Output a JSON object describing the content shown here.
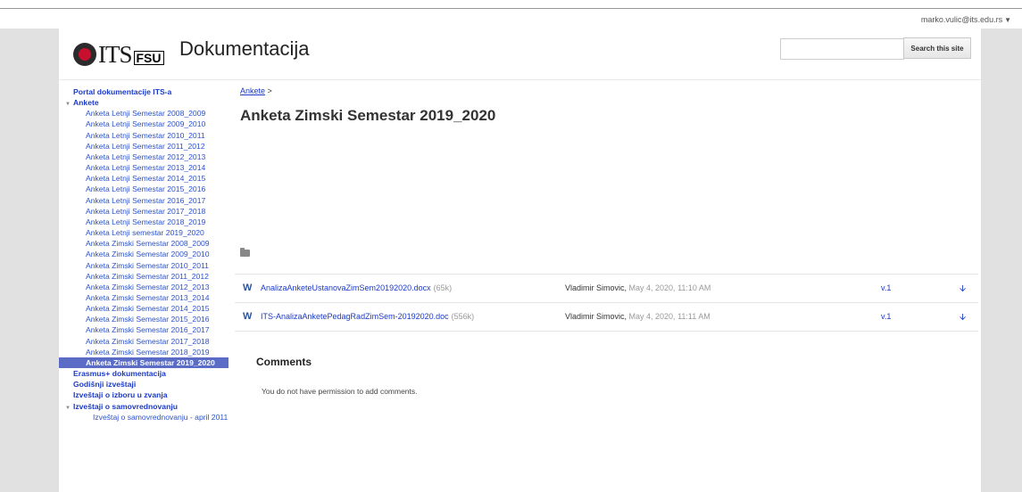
{
  "header": {
    "user_email": "marko.vulic@its.edu.rs",
    "site_title": "Dokumentacija",
    "search_button": "Search this site",
    "search_placeholder": "",
    "logo_text_its": "ITS",
    "logo_text_fsu": "FSU"
  },
  "sidebar": {
    "items": [
      {
        "label": "Portal dokumentacije ITS-a",
        "level": 0
      },
      {
        "label": "Ankete",
        "level": 0,
        "expanded": true
      },
      {
        "label": "Anketa Letnji Semestar 2008_2009",
        "level": 1
      },
      {
        "label": "Anketa Letnji Semestar 2009_2010",
        "level": 1
      },
      {
        "label": "Anketa Letnji Semestar 2010_2011",
        "level": 1
      },
      {
        "label": "Anketa Letnji Semestar 2011_2012",
        "level": 1
      },
      {
        "label": "Anketa Letnji Semestar 2012_2013",
        "level": 1
      },
      {
        "label": "Anketa Letnji Semestar 2013_2014",
        "level": 1
      },
      {
        "label": "Anketa Letnji Semestar 2014_2015",
        "level": 1
      },
      {
        "label": "Anketa Letnji Semestar 2015_2016",
        "level": 1
      },
      {
        "label": "Anketa Letnji Semestar 2016_2017",
        "level": 1
      },
      {
        "label": "Anketa Letnji Semestar 2017_2018",
        "level": 1
      },
      {
        "label": "Anketa Letnji Semestar 2018_2019",
        "level": 1
      },
      {
        "label": "Anketa Letnji semestar 2019_2020",
        "level": 1
      },
      {
        "label": "Anketa Zimski Semestar 2008_2009",
        "level": 1
      },
      {
        "label": "Anketa Zimski Semestar 2009_2010",
        "level": 1
      },
      {
        "label": "Anketa Zimski Semestar 2010_2011",
        "level": 1
      },
      {
        "label": "Anketa Zimski Semestar 2011_2012",
        "level": 1
      },
      {
        "label": "Anketa Zimski Semestar 2012_2013",
        "level": 1
      },
      {
        "label": "Anketa Zimski Semestar 2013_2014",
        "level": 1
      },
      {
        "label": "Anketa Zimski Semestar 2014_2015",
        "level": 1
      },
      {
        "label": "Anketa Zimski Semestar 2015_2016",
        "level": 1
      },
      {
        "label": "Anketa Zimski Semestar 2016_2017",
        "level": 1
      },
      {
        "label": "Anketa Zimski Semestar 2017_2018",
        "level": 1
      },
      {
        "label": "Anketa Zimski Semestar 2018_2019",
        "level": 1
      },
      {
        "label": "Anketa Zimski Semestar 2019_2020",
        "level": 1,
        "selected": true
      },
      {
        "label": "Erasmus+ dokumentacija",
        "level": 0
      },
      {
        "label": "Godišnji izveštaji",
        "level": 0
      },
      {
        "label": "Izveštaji o izboru u zvanja",
        "level": 0
      },
      {
        "label": "Izveštaji o samovrednovanju",
        "level": 0,
        "expanded": true
      },
      {
        "label": "Izveštaj o samovrednovanju - april 2011",
        "level": 2
      }
    ]
  },
  "main": {
    "breadcrumb": "Ankete",
    "breadcrumb_sep": ">",
    "title": "Anketa Zimski Semestar 2019_2020",
    "files": [
      {
        "name": "AnalizaAnketeUstanovaZimSem20192020.docx",
        "size": "(65k)",
        "author": "Vladimir Simovic,",
        "date": "May 4, 2020, 11:10 AM",
        "version": "v.1",
        "icon": "word-icon"
      },
      {
        "name": "ITS-AnalizaAnketePedagRadZimSem-20192020.doc",
        "size": "(556k)",
        "author": "Vladimir Simovic,",
        "date": "May 4, 2020, 11:11 AM",
        "version": "v.1",
        "icon": "word-icon"
      }
    ],
    "comments_title": "Comments",
    "comments_message": "You do not have permission to add comments."
  },
  "colors": {
    "link": "#1a3ac8",
    "selected_bg": "#5a6cc6",
    "gutter": "#e1e1e1",
    "word_icon": "#2a5699"
  }
}
